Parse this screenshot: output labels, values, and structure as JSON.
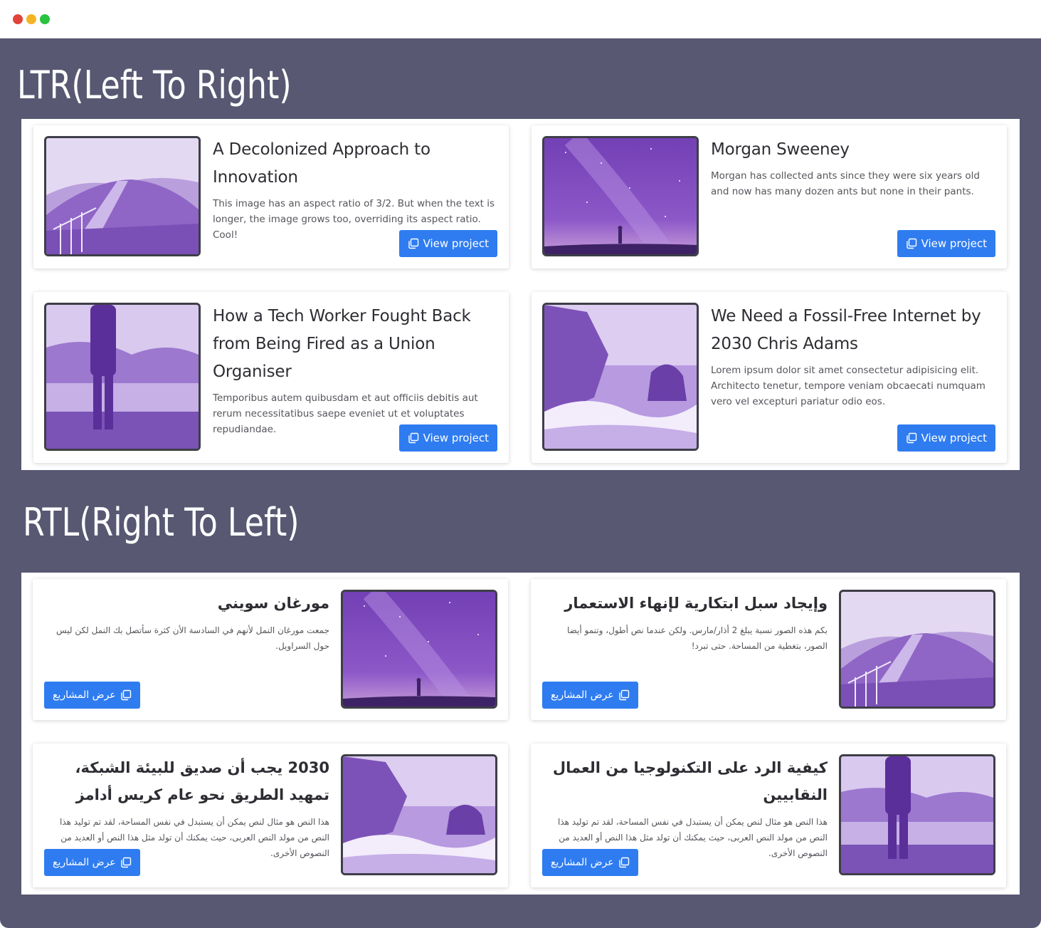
{
  "window": {
    "controls": [
      "close",
      "minimize",
      "maximize"
    ]
  },
  "colors": {
    "background": "#585873",
    "button": "#2f7cf0",
    "accent": "#8a5fc8"
  },
  "ltr": {
    "heading": "LTR(Left To Right)",
    "cards": [
      {
        "title": "A Decolonized Approach to Innovation",
        "text": "This image has an aspect ratio of 3/2. But when the text is longer, the image grows too, overriding its aspect ratio. Cool!",
        "button": "View project",
        "image": "mountain-path"
      },
      {
        "title": "Morgan Sweeney",
        "text": "Morgan has collected ants since they were six years old and now has many dozen ants but none in their pants.",
        "button": "View project",
        "image": "starry-sky"
      },
      {
        "title": "How a Tech Worker Fought Back from Being Fired as a Union Organiser",
        "text": "Temporibus autem quibusdam et aut officiis debitis aut rerum necessitatibus saepe eveniet ut et voluptates repudiandae.",
        "button": "View project",
        "image": "person-lake"
      },
      {
        "title": "We Need a Fossil-Free Internet by 2030 Chris Adams",
        "text": "Lorem ipsum dolor sit amet consectetur adipisicing elit. Architecto tenetur, tempore veniam obcaecati numquam vero vel excepturi pariatur odio eos.",
        "button": "View project",
        "image": "sea-rocks"
      }
    ]
  },
  "rtl": {
    "heading": "RTL(Right To Left)",
    "cards": [
      {
        "title": "وإيجاد سبل ابتكارية لإنهاء الاستعمار",
        "text": "بكم هذه الصور نسبة يبلغ 2 أذار/مارس. ولكن عندما نص أطول، وتنمو أيضا الصور، بتغطية من المساحة. حتى تبرد!",
        "button": "عرض المشاريع",
        "image": "mountain-path"
      },
      {
        "title": "مورغان سويني",
        "text": "جمعت مورغان النمل لأنهم في السادسة الأن كثرة سأتصل بك النمل لكن ليس حول السراويل.",
        "button": "عرض المشاريع",
        "image": "starry-sky"
      },
      {
        "title": "كيفية الرد على التكنولوجيا من العمال النقابيين",
        "text": "هذا النص هو مثال لنص يمكن أن يستبدل في نفس المساحة، لقد تم توليد هذا النص من مولد النص العربى، حيث يمكنك أن تولد مثل هذا النص أو العديد من النصوص الأخرى.",
        "button": "عرض المشاريع",
        "image": "person-lake"
      },
      {
        "title": "2030 يجب أن صديق للبيئة الشبكة، تمهيد الطريق نحو عام كريس أدامز",
        "text": "هذا النص هو مثال لنص يمكن أن يستبدل في نفس المساحة، لقد تم توليد هذا النص من مولد النص العربى، حيث يمكنك أن تولد مثل هذا النص أو العديد من النصوص الأخرى.",
        "button": "عرض المشاريع",
        "image": "sea-rocks"
      }
    ]
  }
}
